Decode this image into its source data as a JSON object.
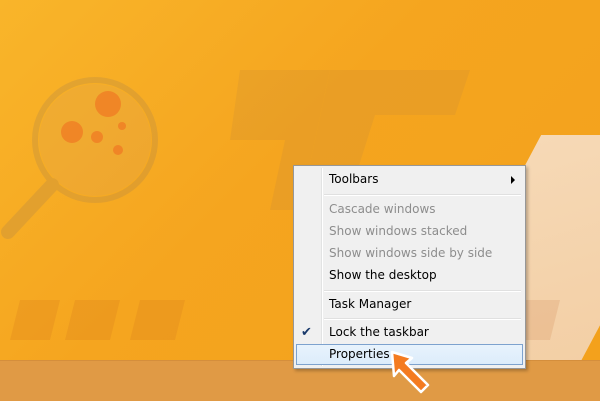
{
  "context_menu": {
    "items": [
      {
        "label": "Toolbars",
        "state": "enabled",
        "submenu": true
      },
      {
        "label": "Cascade windows",
        "state": "disabled"
      },
      {
        "label": "Show windows stacked",
        "state": "disabled"
      },
      {
        "label": "Show windows side by side",
        "state": "disabled"
      },
      {
        "label": "Show the desktop",
        "state": "enabled"
      },
      {
        "label": "Task Manager",
        "state": "enabled"
      },
      {
        "label": "Lock the taskbar",
        "state": "enabled",
        "checked": true
      },
      {
        "label": "Properties",
        "state": "hovered"
      }
    ]
  },
  "icons": {
    "submenu": "chevron-right-icon",
    "check": "checkmark-icon",
    "pointer": "orange-arrow-pointer-icon",
    "watermark": "magnifier-logo-icon"
  },
  "colors": {
    "wallpaper": "#f7a823",
    "taskbar": "#e09a45",
    "menu_bg": "#f0f0f0",
    "hover_border": "#7da2ce",
    "pointer": "#f47b20"
  }
}
